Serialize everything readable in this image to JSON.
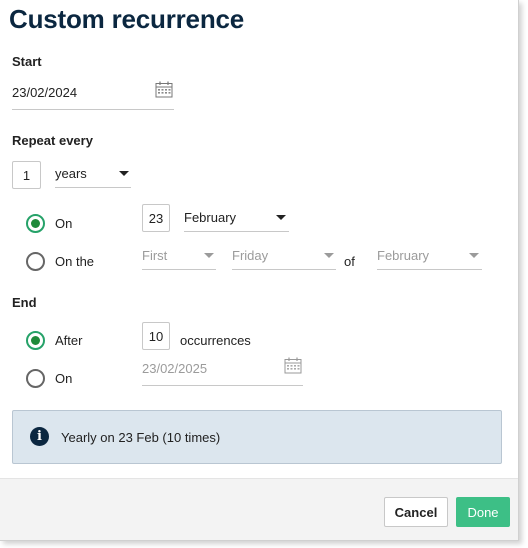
{
  "title": "Custom recurrence",
  "start": {
    "label": "Start",
    "date_value": "23/02/2024"
  },
  "repeat": {
    "label": "Repeat every",
    "interval_value": "1",
    "unit_value": "years"
  },
  "monthly_mode": {
    "on_label": "On",
    "on_selected": true,
    "day_value": "23",
    "month_value": "February",
    "on_the_label": "On the",
    "ordinal_value": "First",
    "weekday_value": "Friday",
    "of_label": "of",
    "of_month_value": "February"
  },
  "end": {
    "label": "End",
    "after_label": "After",
    "after_selected": true,
    "occurrences_value": "10",
    "occurrences_label": "occurrences",
    "on_label": "On",
    "on_date_value": "23/02/2025"
  },
  "summary": {
    "icon": "info-icon",
    "text": "Yearly on 23 Feb (10 times)"
  },
  "footer": {
    "cancel_label": "Cancel",
    "done_label": "Done"
  },
  "colors": {
    "title": "#0b2740",
    "radio_checked": "#1f8a3a",
    "done_button": "#3dbf86",
    "info_background": "#dce6ee"
  }
}
